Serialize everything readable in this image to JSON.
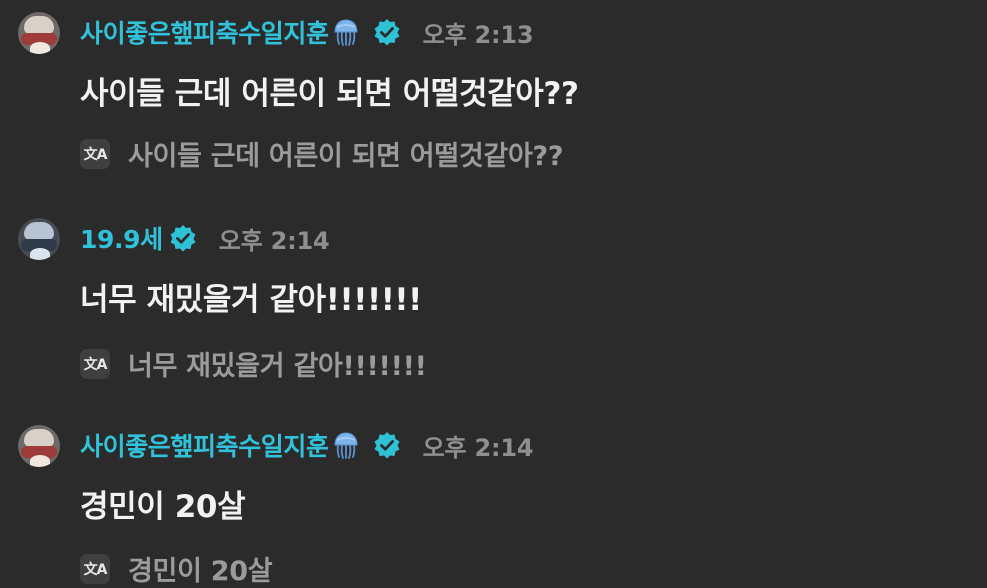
{
  "messages": [
    {
      "username": "사이좋은햎피축수일지훈",
      "user_emoji": "jellyfish-icon",
      "verified": true,
      "timestamp": "오후 2:13",
      "text": "사이들 근데 어른이 되면 어떨것같아??",
      "translation": "사이들 근데 어른이 되면 어떨것같아??"
    },
    {
      "username": "19.9세",
      "verified": true,
      "timestamp": "오후 2:14",
      "text": "너무 재밌을거 같아!!!!!!!",
      "translation": "너무 재밌을거 같아!!!!!!!"
    },
    {
      "username": "사이좋은햎피축수일지훈",
      "user_emoji": "jellyfish-icon",
      "verified": true,
      "timestamp": "오후 2:14",
      "text": "경민이 20살",
      "translation": "경민이 20살"
    }
  ],
  "translate_icon_label": "文A",
  "colors": {
    "background": "#2b2b2b",
    "username": "#31c2d9",
    "verified_badge": "#2fc1d6",
    "message_text": "#f2f2f2",
    "translation_text": "#9b9b9b",
    "timestamp": "#8f8f8f"
  }
}
